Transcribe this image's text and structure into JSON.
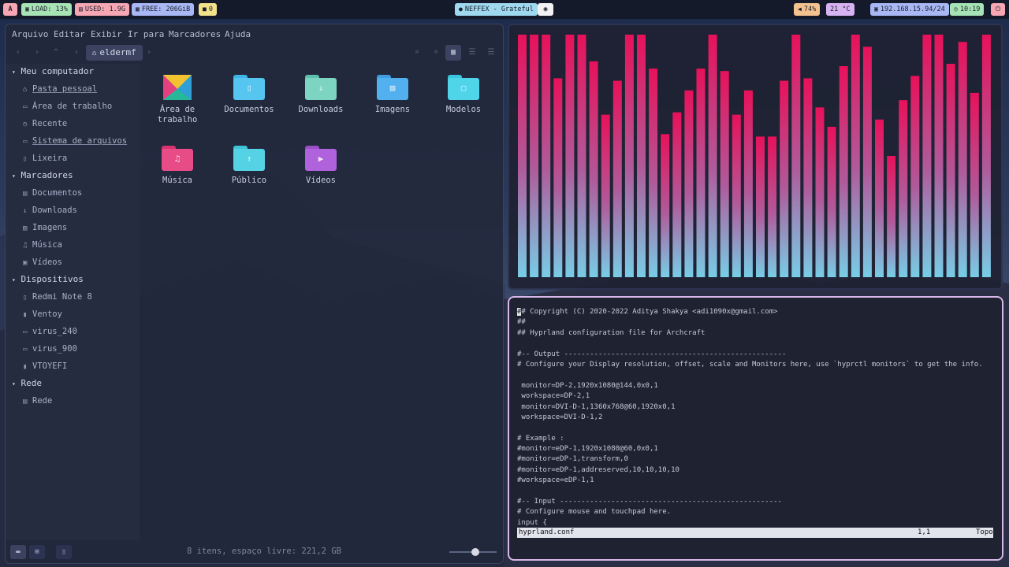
{
  "topbar": {
    "logo": "A",
    "load": "LOAD: 13%",
    "used": "USED: 1.9G",
    "free": "FREE: 206GiB",
    "updates": "0",
    "music": "NEFFEX - Grateful",
    "volume": "74%",
    "temp": "21 °C",
    "ip": "192.168.15.94/24",
    "clock": "10:19"
  },
  "colors": {
    "pill_red": "#f7a7b3",
    "pill_green": "#a7e3b5",
    "pill_blue": "#a9b8f5",
    "pill_yellow": "#f2e28a",
    "pill_cyan": "#9fd9f0",
    "pill_orange": "#f4c28f",
    "pill_purple": "#d8b3f2",
    "bar_top": "#e8115a",
    "bar_bottom": "#78cde6",
    "terminal_border": "#d7b8e8"
  },
  "file_manager": {
    "menu": [
      "Arquivo",
      "Editar",
      "Exibir",
      "Ir para",
      "Marcadores",
      "Ajuda"
    ],
    "breadcrumb": "eldermf",
    "sidebar": {
      "computer_header": "Meu computador",
      "computer_items": [
        "Pasta pessoal",
        "Área de trabalho",
        "Recente",
        "Sistema de arquivos",
        "Lixeira"
      ],
      "bookmarks_header": "Marcadores",
      "bookmark_items": [
        "Documentos",
        "Downloads",
        "Imagens",
        "Música",
        "Vídeos"
      ],
      "devices_header": "Dispositivos",
      "device_items": [
        "Redmi Note 8",
        "Ventoy",
        "virus_240",
        "virus_900",
        "VTOYEFI"
      ],
      "network_header": "Rede",
      "network_items": [
        "Rede"
      ]
    },
    "items": [
      {
        "label": "Área de\ntrabalho",
        "icon": "desktop-icon"
      },
      {
        "label": "Documentos",
        "icon": "documents-folder-icon"
      },
      {
        "label": "Downloads",
        "icon": "downloads-folder-icon"
      },
      {
        "label": "Imagens",
        "icon": "images-folder-icon"
      },
      {
        "label": "Modelos",
        "icon": "templates-folder-icon"
      },
      {
        "label": "Música",
        "icon": "music-folder-icon"
      },
      {
        "label": "Público",
        "icon": "public-folder-icon"
      },
      {
        "label": "Vídeos",
        "icon": "videos-folder-icon"
      }
    ],
    "status": "8 itens, espaço livre: 221,2 GB",
    "zoom_level": 0.55
  },
  "visualizer": {
    "levels": [
      1.0,
      1.0,
      1.0,
      0.82,
      1.0,
      1.0,
      0.89,
      0.67,
      0.81,
      1.0,
      1.0,
      0.86,
      0.59,
      0.68,
      0.77,
      0.86,
      1.0,
      0.85,
      0.67,
      0.77,
      0.58,
      0.58,
      0.81,
      1.0,
      0.82,
      0.7,
      0.62,
      0.87,
      1.0,
      0.95,
      0.65,
      0.5,
      0.73,
      0.83,
      1.0,
      1.0,
      0.88,
      0.97,
      0.76,
      1.0
    ]
  },
  "terminal": {
    "lines": [
      "## Copyright (C) 2020-2022 Aditya Shakya <adi1090x@gmail.com>",
      "##",
      "## Hyprland configuration file for Archcraft",
      "",
      "#-- Output ----------------------------------------------------",
      "# Configure your Display resolution, offset, scale and Monitors here, use `hyprctl monitors` to get the info.",
      "",
      " monitor=DP-2,1920x1080@144,0x0,1",
      " workspace=DP-2,1",
      " monitor=DVI-D-1,1360x768@60,1920x0,1",
      " workspace=DVI-D-1,2",
      "",
      "# Example :",
      "#monitor=eDP-1,1920x1080@60,0x0,1",
      "#monitor=eDP-1,transform,0",
      "#monitor=eDP-1,addreserved,10,10,10,10",
      "#workspace=eDP-1,1",
      "",
      "#-- Input ----------------------------------------------------",
      "# Configure mouse and touchpad here.",
      "input {"
    ],
    "status_file": "hyprland.conf",
    "status_pos": "1,1",
    "status_scroll": "Topo"
  }
}
